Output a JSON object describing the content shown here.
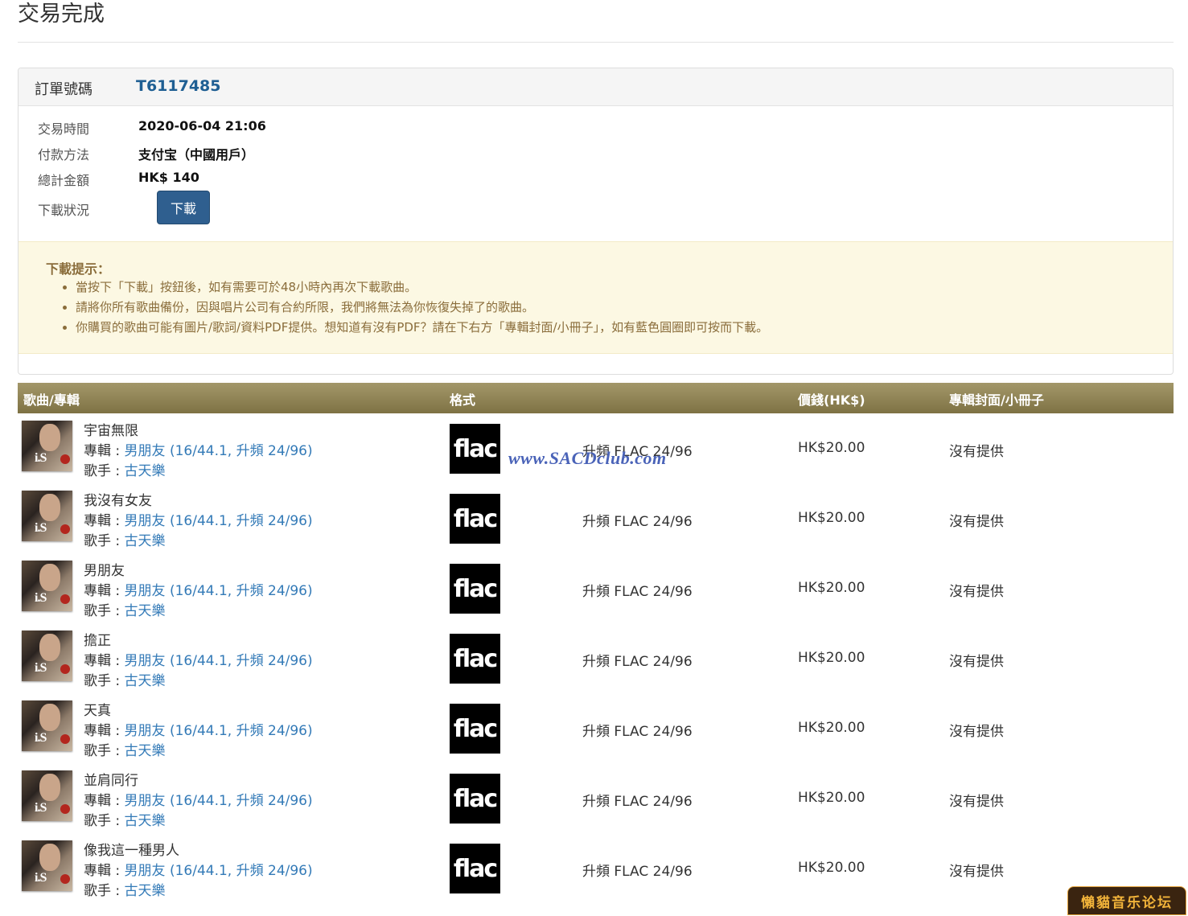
{
  "page": {
    "title": "交易完成"
  },
  "order": {
    "label": "訂單號碼",
    "number": "T6117485",
    "fields": [
      {
        "label": "交易時間",
        "value": "2020-06-04 21:06"
      },
      {
        "label": "付款方法",
        "value": "支付宝（中國用戶）"
      },
      {
        "label": "總計金額",
        "value": "HK$ 140"
      }
    ],
    "download_label": "下載狀況",
    "download_button": "下載"
  },
  "notice": {
    "title": "下載提示：",
    "items": [
      "當按下「下載」按鈕後，如有需要可於48小時內再次下載歌曲。",
      "請將你所有歌曲備份，因與唱片公司有合約所限，我們將無法為你恢復失掉了的歌曲。",
      "你購買的歌曲可能有圖片/歌詞/資料PDF提供。想知道有沒有PDF？請在下右方「專輯封面/小冊子」，如有藍色圓圈即可按而下載。"
    ]
  },
  "table": {
    "headers": {
      "song": "歌曲/專輯",
      "format": "格式",
      "price": "價錢(HK$)",
      "booklet": "專輯封面/小冊子"
    },
    "album_prefix": "專輯 : ",
    "artist_prefix": "歌手 : ",
    "rows": [
      {
        "song": "宇宙無限",
        "album": "男朋友 (16/44.1, 升頻 24/96)",
        "artist": "古天樂",
        "format_icon": "flac",
        "format": "升頻 FLAC 24/96",
        "price": "HK$20.00",
        "booklet": "沒有提供"
      },
      {
        "song": "我沒有女友",
        "album": "男朋友 (16/44.1, 升頻 24/96)",
        "artist": "古天樂",
        "format_icon": "flac",
        "format": "升頻 FLAC 24/96",
        "price": "HK$20.00",
        "booklet": "沒有提供"
      },
      {
        "song": "男朋友",
        "album": "男朋友 (16/44.1, 升頻 24/96)",
        "artist": "古天樂",
        "format_icon": "flac",
        "format": "升頻 FLAC 24/96",
        "price": "HK$20.00",
        "booklet": "沒有提供"
      },
      {
        "song": "擔正",
        "album": "男朋友 (16/44.1, 升頻 24/96)",
        "artist": "古天樂",
        "format_icon": "flac",
        "format": "升頻 FLAC 24/96",
        "price": "HK$20.00",
        "booklet": "沒有提供"
      },
      {
        "song": "天真",
        "album": "男朋友 (16/44.1, 升頻 24/96)",
        "artist": "古天樂",
        "format_icon": "flac",
        "format": "升頻 FLAC 24/96",
        "price": "HK$20.00",
        "booklet": "沒有提供"
      },
      {
        "song": "並肩同行",
        "album": "男朋友 (16/44.1, 升頻 24/96)",
        "artist": "古天樂",
        "format_icon": "flac",
        "format": "升頻 FLAC 24/96",
        "price": "HK$20.00",
        "booklet": "沒有提供"
      },
      {
        "song": "像我這一種男人",
        "album": "男朋友 (16/44.1, 升頻 24/96)",
        "artist": "古天樂",
        "format_icon": "flac",
        "format": "升頻 FLAC 24/96",
        "price": "HK$20.00",
        "booklet": "沒有提供"
      }
    ]
  },
  "cover_logo": "i.S",
  "watermark": "www.SACDclub.com",
  "forum_badge": "懶貓音乐论坛",
  "colors": {
    "accent": "#2f5f8f",
    "link": "#337ab7",
    "table_header": "#8f8357",
    "notice_bg": "#fcf8e3"
  }
}
